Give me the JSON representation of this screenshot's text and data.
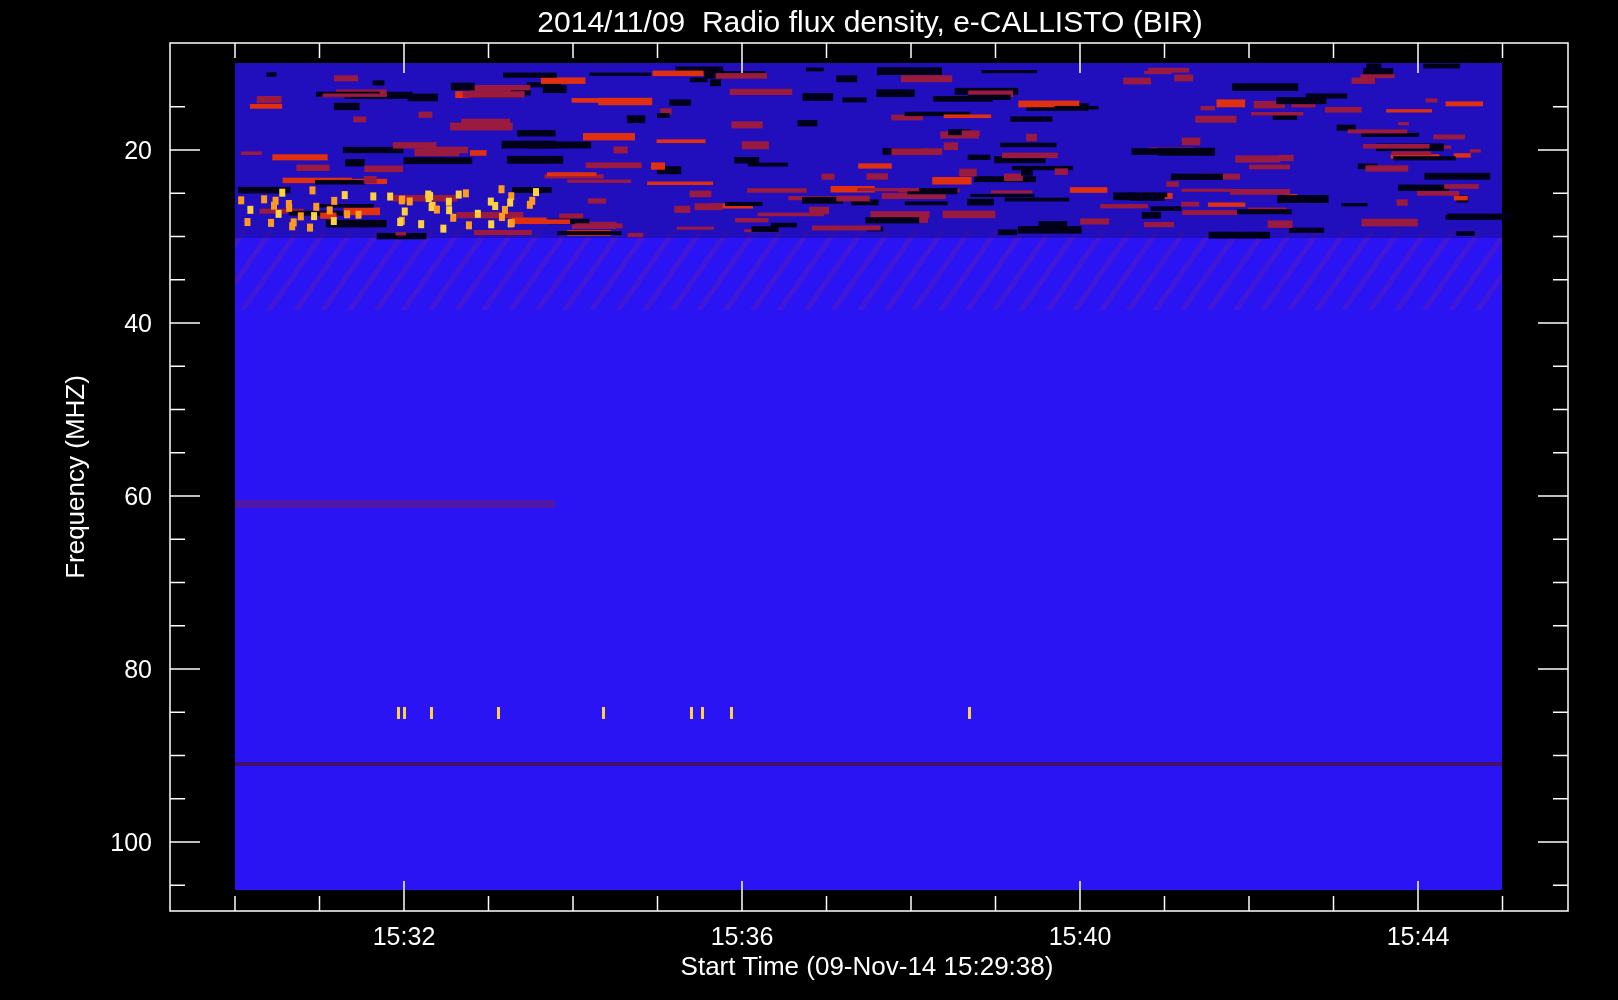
{
  "title": "2014/11/09  Radio flux density, e-CALLISTO (BIR)",
  "plot": {
    "ylabel": "Frequency (MHZ)",
    "xlabel": "Start Time (09-Nov-14 15:29:38)",
    "yticks": [
      "20",
      "40",
      "60",
      "80",
      "100"
    ],
    "xticks": [
      "15:32",
      "15:36",
      "15:40",
      "15:44"
    ]
  }
}
